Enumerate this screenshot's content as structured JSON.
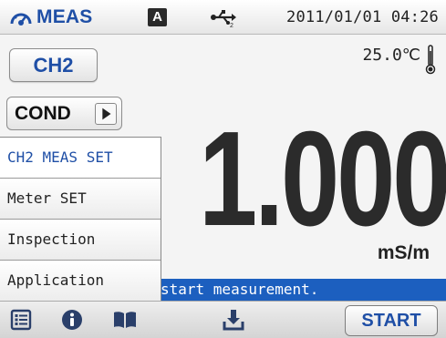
{
  "status_bar": {
    "mode_icon": "gauge-icon",
    "mode_label": "MEAS",
    "mode_badge": "A",
    "usb_icon": "usb-icon",
    "datetime": "2011/01/01 04:26"
  },
  "channel": {
    "label": "CH2"
  },
  "temperature": {
    "value": "25.0℃",
    "icon": "thermometer-icon"
  },
  "parameter": {
    "label": "COND",
    "next_icon": "play-arrow-icon"
  },
  "reading": {
    "value": "1.000",
    "unit": "mS/m"
  },
  "message": "start measurement.",
  "menu": {
    "items": [
      {
        "label": "CH2 MEAS SET"
      },
      {
        "label": "Meter SET"
      },
      {
        "label": "Inspection"
      },
      {
        "label": "Application"
      }
    ]
  },
  "toolbar": {
    "icons": [
      "menu-list-icon",
      "info-icon",
      "book-icon",
      "download-icon"
    ],
    "start_label": "START"
  },
  "colors": {
    "accent": "#1f4fa6",
    "message_bar": "#1c5fbf",
    "reading": "#2b2b2b"
  }
}
